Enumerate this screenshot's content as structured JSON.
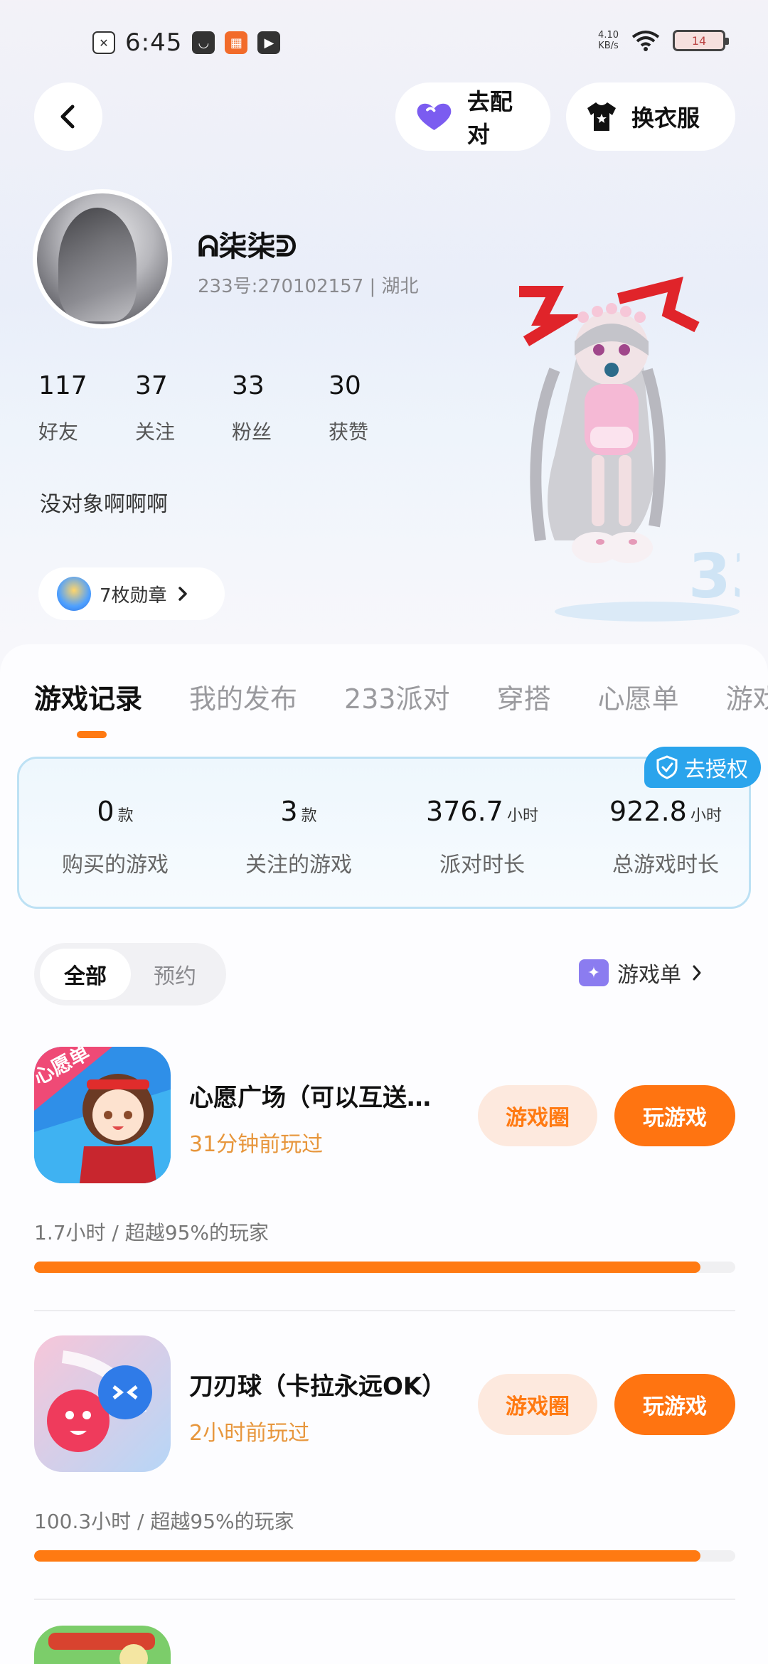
{
  "status_bar": {
    "time": "6:45",
    "net_speed_value": "4.10",
    "net_speed_unit": "KB/s",
    "battery": "14"
  },
  "header": {
    "match_label": "去配对",
    "outfit_label": "换衣服"
  },
  "profile": {
    "nickname": "ᕱ柒柒ᕲ",
    "uid_line": "233号:270102157 | 湖北",
    "bio": "没对象啊啊啊",
    "badges_label": "7枚勋章",
    "stats": [
      {
        "value": "117",
        "label": "好友"
      },
      {
        "value": "37",
        "label": "关注"
      },
      {
        "value": "33",
        "label": "粉丝"
      },
      {
        "value": "30",
        "label": "获赞"
      }
    ]
  },
  "tabs": [
    "游戏记录",
    "我的发布",
    "233派对",
    "穿搭",
    "心愿单",
    "游戏"
  ],
  "summary": {
    "auth_label": "去授权",
    "cells": [
      {
        "value": "0",
        "unit": "款",
        "label": "购买的游戏"
      },
      {
        "value": "3",
        "unit": "款",
        "label": "关注的游戏"
      },
      {
        "value": "376.7",
        "unit": "小时",
        "label": "派对时长"
      },
      {
        "value": "922.8",
        "unit": "小时",
        "label": "总游戏时长"
      }
    ]
  },
  "filter": {
    "all_label": "全部",
    "reserve_label": "预约",
    "gamelist_label": "游戏单"
  },
  "games": [
    {
      "title": "心愿广场（可以互送…",
      "last_played": "31分钟前玩过",
      "stat": "1.7小时 / 超越95%的玩家",
      "progress_pct": 95,
      "circle_label": "游戏圈",
      "play_label": "玩游戏",
      "icon_banner": "心愿单"
    },
    {
      "title": "刀刃球（卡拉永远OK）",
      "last_played": "2小时前玩过",
      "stat": "100.3小时 / 超越95%的玩家",
      "progress_pct": 95,
      "circle_label": "游戏圈",
      "play_label": "玩游戏"
    }
  ],
  "colors": {
    "accent": "#ff7a12",
    "auth_blue": "#2aa4ec",
    "heart_purple": "#7b5cf0"
  }
}
